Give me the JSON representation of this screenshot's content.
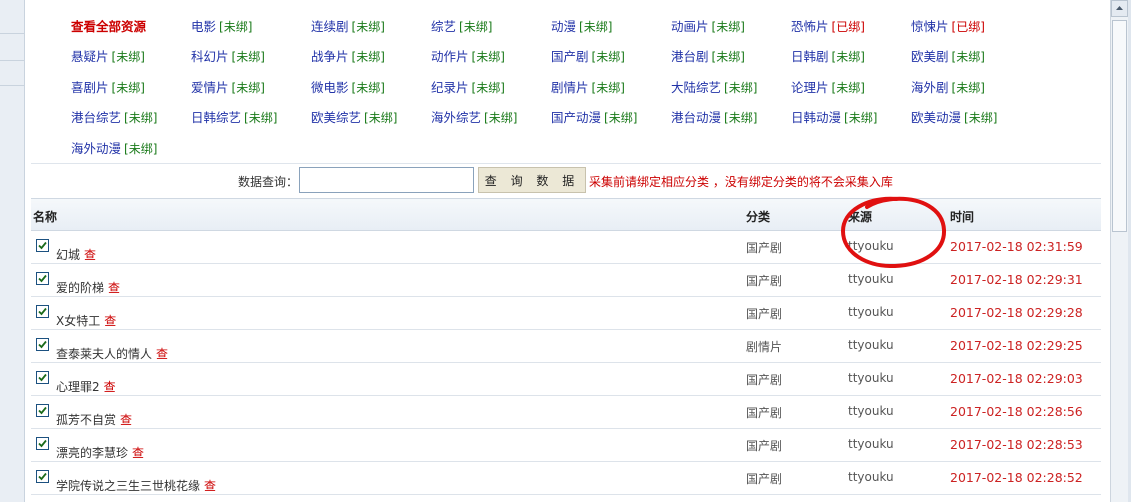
{
  "categories": [
    [
      {
        "name": "查看全部资源",
        "tag": "",
        "all": true
      },
      {
        "name": "电影",
        "tag": "[未绑]"
      },
      {
        "name": "连续剧",
        "tag": "[未绑]"
      },
      {
        "name": "综艺",
        "tag": "[未绑]"
      },
      {
        "name": "动漫",
        "tag": "[未绑]"
      },
      {
        "name": "动画片",
        "tag": "[未绑]"
      },
      {
        "name": "恐怖片",
        "tag": "[已绑]",
        "bound": true
      },
      {
        "name": "惊悚片",
        "tag": "[已绑]",
        "bound": true
      }
    ],
    [
      {
        "name": "悬疑片",
        "tag": "[未绑]"
      },
      {
        "name": "科幻片",
        "tag": "[未绑]"
      },
      {
        "name": "战争片",
        "tag": "[未绑]"
      },
      {
        "name": "动作片",
        "tag": "[未绑]"
      },
      {
        "name": "国产剧",
        "tag": "[未绑]"
      },
      {
        "name": "港台剧",
        "tag": "[未绑]"
      },
      {
        "name": "日韩剧",
        "tag": "[未绑]"
      },
      {
        "name": "欧美剧",
        "tag": "[未绑]"
      }
    ],
    [
      {
        "name": "喜剧片",
        "tag": "[未绑]"
      },
      {
        "name": "爱情片",
        "tag": "[未绑]"
      },
      {
        "name": "微电影",
        "tag": "[未绑]"
      },
      {
        "name": "纪录片",
        "tag": "[未绑]"
      },
      {
        "name": "剧情片",
        "tag": "[未绑]"
      },
      {
        "name": "大陆综艺",
        "tag": "[未绑]"
      },
      {
        "name": "论理片",
        "tag": "[未绑]"
      },
      {
        "name": "海外剧",
        "tag": "[未绑]"
      }
    ],
    [
      {
        "name": "港台综艺",
        "tag": "[未绑]"
      },
      {
        "name": "日韩综艺",
        "tag": "[未绑]"
      },
      {
        "name": "欧美综艺",
        "tag": "[未绑]"
      },
      {
        "name": "海外综艺",
        "tag": "[未绑]"
      },
      {
        "name": "国产动漫",
        "tag": "[未绑]"
      },
      {
        "name": "港台动漫",
        "tag": "[未绑]"
      },
      {
        "name": "日韩动漫",
        "tag": "[未绑]"
      },
      {
        "name": "欧美动漫",
        "tag": "[未绑]"
      }
    ],
    [
      {
        "name": "海外动漫",
        "tag": "[未绑]"
      }
    ]
  ],
  "search": {
    "label": "数据查询：",
    "value": "",
    "button": "查 询 数 据",
    "note": "采集前请绑定相应分类 ，没有绑定分类的将不会采集入库"
  },
  "table": {
    "headers": {
      "name": "名称",
      "category": "分类",
      "source": "来源",
      "time": "时间"
    },
    "view_label": "查",
    "rows": [
      {
        "title": "幻城",
        "category": "国产剧",
        "source": "ttyouku",
        "time": "2017-02-18 02:31:59"
      },
      {
        "title": "爱的阶梯",
        "category": "国产剧",
        "source": "ttyouku",
        "time": "2017-02-18 02:29:31"
      },
      {
        "title": "X女特工",
        "category": "国产剧",
        "source": "ttyouku",
        "time": "2017-02-18 02:29:28"
      },
      {
        "title": "查泰莱夫人的情人",
        "category": "剧情片",
        "source": "ttyouku",
        "time": "2017-02-18 02:29:25"
      },
      {
        "title": "心理罪2",
        "category": "国产剧",
        "source": "ttyouku",
        "time": "2017-02-18 02:29:03"
      },
      {
        "title": "孤芳不自赏",
        "category": "国产剧",
        "source": "ttyouku",
        "time": "2017-02-18 02:28:56"
      },
      {
        "title": "漂亮的李慧珍",
        "category": "国产剧",
        "source": "ttyouku",
        "time": "2017-02-18 02:28:53"
      },
      {
        "title": "学院传说之三生三世桃花缘",
        "category": "国产剧",
        "source": "ttyouku",
        "time": "2017-02-18 02:28:52"
      }
    ]
  },
  "colors": {
    "link": "#2233a8",
    "unbound": "#1a7a1a",
    "bound": "#cc0000",
    "time": "#cc2222",
    "annotation": "#e01010"
  }
}
